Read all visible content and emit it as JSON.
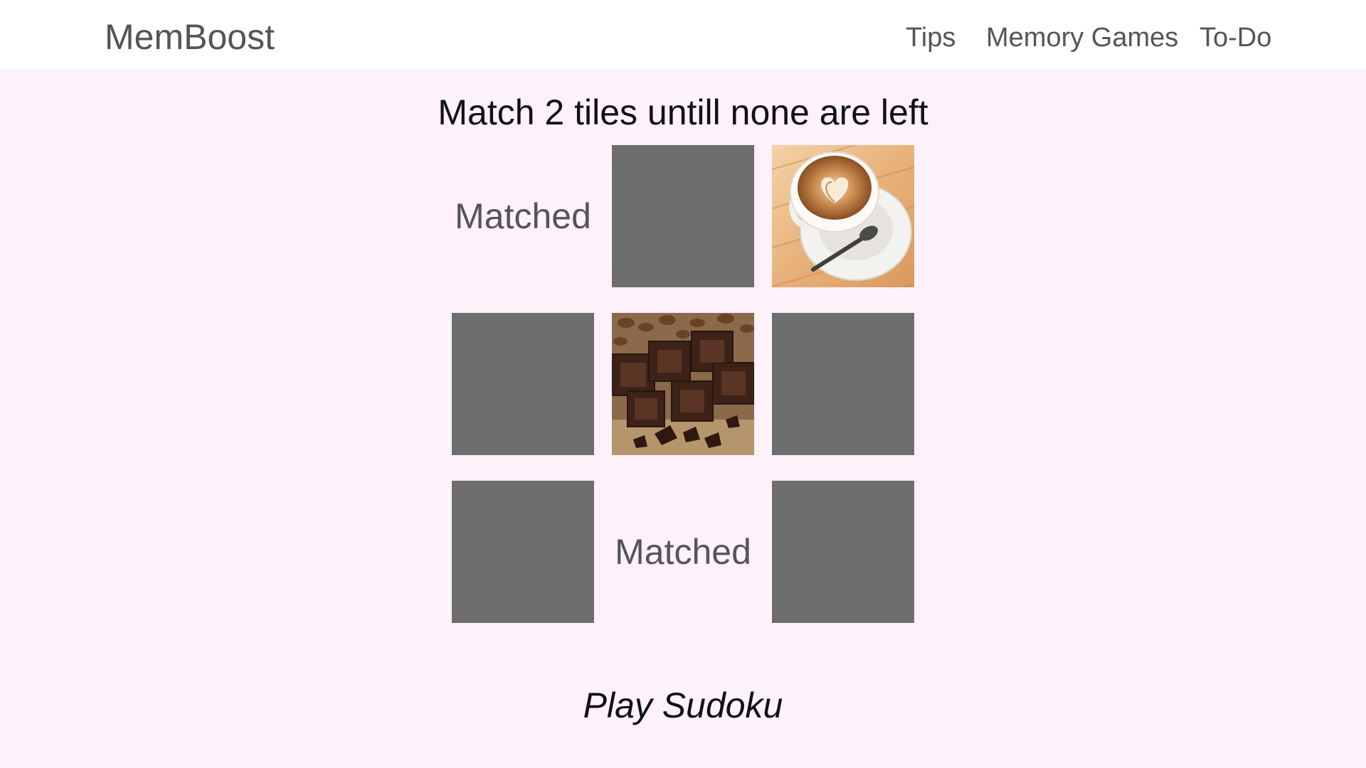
{
  "header": {
    "brand": "MemBoost",
    "nav": {
      "tips": "Tips",
      "memory_games": "Memory Games",
      "todo": "To-Do"
    }
  },
  "game": {
    "instruction": "Match 2 tiles untill none are left",
    "tiles": [
      {
        "state": "matched",
        "label": "Matched"
      },
      {
        "state": "hidden"
      },
      {
        "state": "revealed",
        "image": "coffee-latte"
      },
      {
        "state": "hidden"
      },
      {
        "state": "revealed",
        "image": "chocolate-pieces"
      },
      {
        "state": "hidden"
      },
      {
        "state": "hidden"
      },
      {
        "state": "matched",
        "label": "Matched"
      },
      {
        "state": "hidden"
      }
    ]
  },
  "footer": {
    "play_link": "Play Sudoku"
  },
  "colors": {
    "page_background": "#fdf1fa",
    "header_background": "#ffffff",
    "hidden_tile": "#6e6e6e",
    "muted_text": "#555555"
  }
}
